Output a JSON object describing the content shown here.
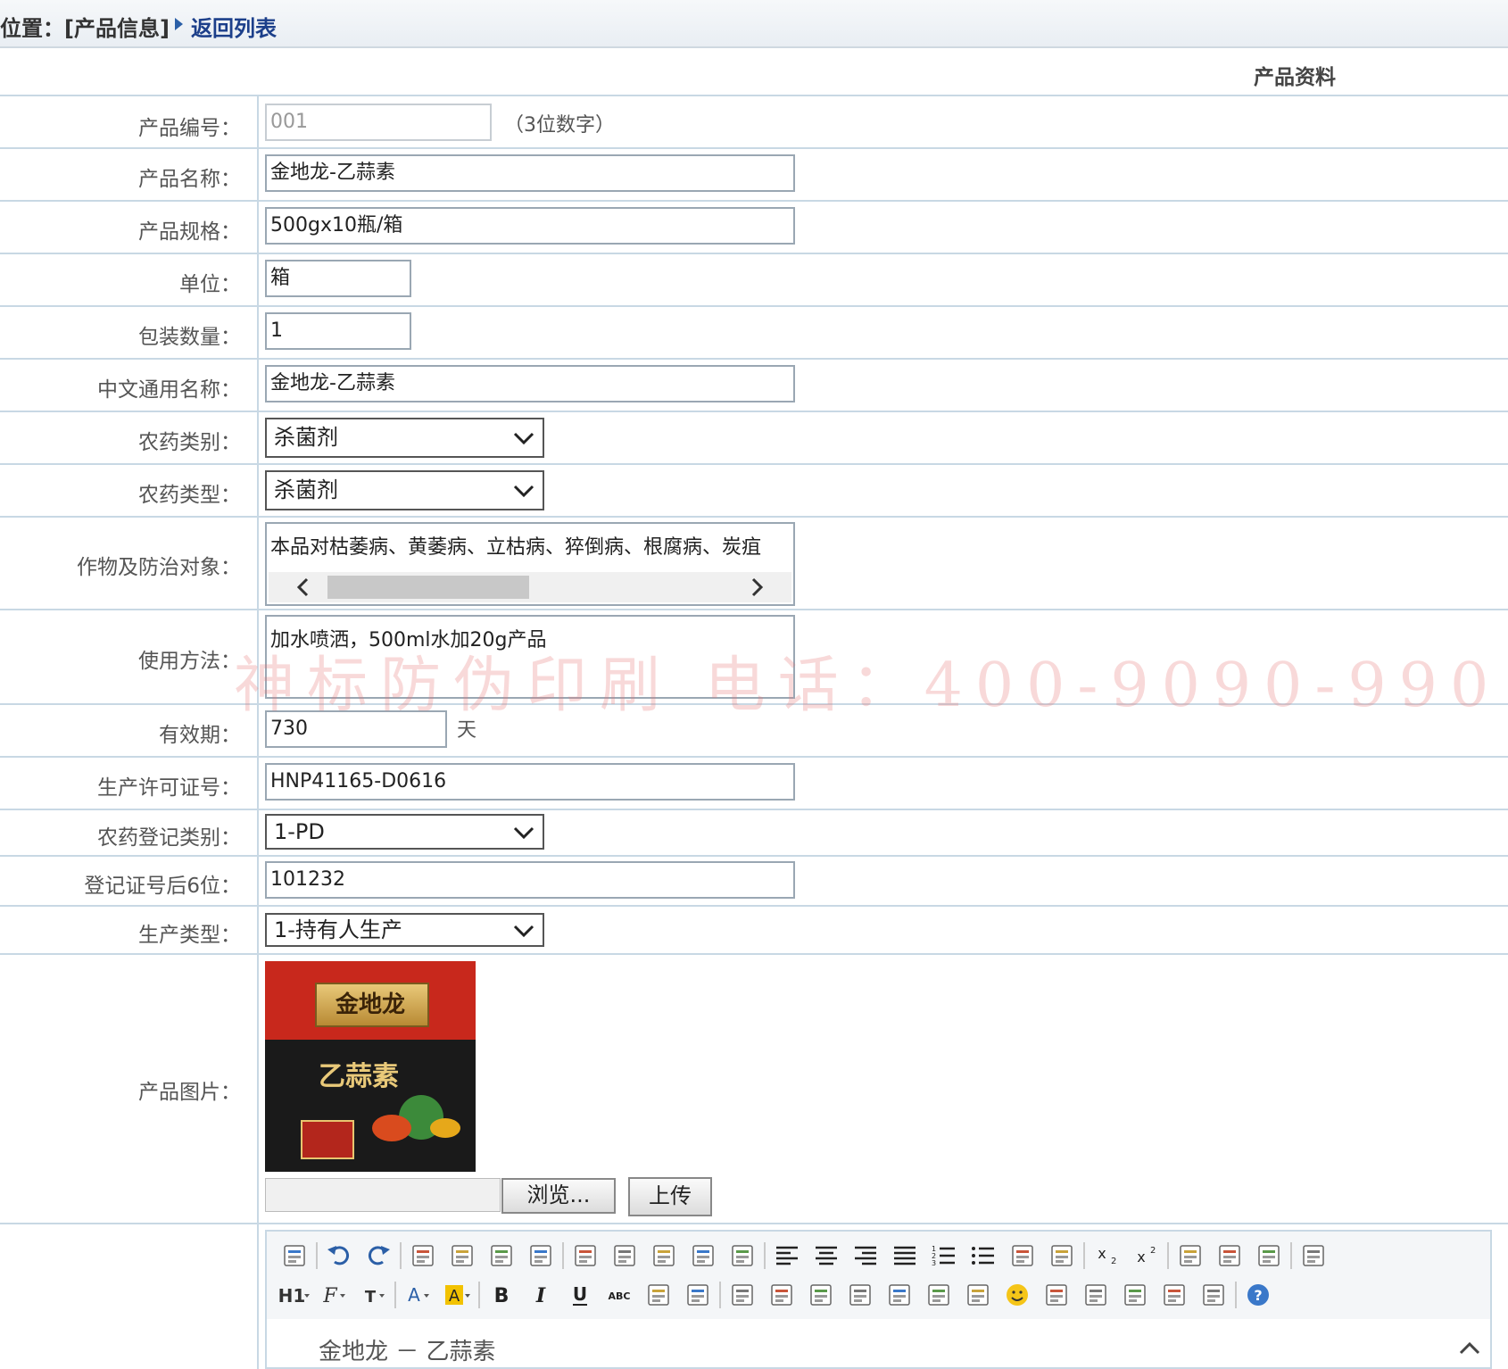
{
  "breadcrumb": {
    "prefix": "位置：[产品信息]",
    "back_link": "返回列表"
  },
  "section_title": "产品资料",
  "fields": {
    "code": {
      "label": "产品编号：",
      "value": "001",
      "hint": "（3位数字）"
    },
    "name": {
      "label": "产品名称：",
      "value": "金地龙-乙蒜素"
    },
    "spec": {
      "label": "产品规格：",
      "value": "500gx10瓶/箱"
    },
    "unit": {
      "label": "单位：",
      "value": "箱"
    },
    "pack_qty": {
      "label": "包装数量：",
      "value": "1"
    },
    "common_name": {
      "label": "中文通用名称：",
      "value": "金地龙-乙蒜素"
    },
    "pesticide_category": {
      "label": "农药类别：",
      "value": "杀菌剂"
    },
    "pesticide_type": {
      "label": "农药类型：",
      "value": "杀菌剂"
    },
    "crop_target": {
      "label": "作物及防治对象：",
      "value": "本品对枯萎病、黄萎病、立枯病、猝倒病、根腐病、炭疽"
    },
    "usage": {
      "label": "使用方法：",
      "value": "加水喷洒，500ml水加20g产品"
    },
    "shelf_life": {
      "label": "有效期：",
      "value": "730",
      "unit": "天"
    },
    "license_no": {
      "label": "生产许可证号：",
      "value": "HNP41165-D0616"
    },
    "reg_category": {
      "label": "农药登记类别：",
      "value": "1-PD"
    },
    "reg_last6": {
      "label": "登记证号后6位：",
      "value": "101232"
    },
    "production_type": {
      "label": "生产类型：",
      "value": "1-持有人生产"
    },
    "product_image": {
      "label": "产品图片：",
      "brand_text": "金地龙",
      "product_text": "乙蒜素",
      "browse_label": "浏览...",
      "upload_label": "上传"
    }
  },
  "watermark": "神标防伪印刷  电话：400-9090-990",
  "editor": {
    "content": "金地龙 － 乙蒜素",
    "toolbar_row1": [
      "source-icon",
      "undo-icon",
      "redo-icon",
      "preview-icon",
      "print-icon",
      "template-icon",
      "code-icon",
      "cut-icon",
      "copy-icon",
      "paste-icon",
      "paste-text-icon",
      "paste-word-icon",
      "align-left-icon",
      "align-center-icon",
      "align-right-icon",
      "justify-icon",
      "ordered-list-icon",
      "unordered-list-icon",
      "indent-icon",
      "outdent-icon",
      "subscript-icon",
      "superscript-icon",
      "clear-format-icon",
      "select-all-icon",
      "select-icon",
      "fullscreen-icon"
    ],
    "toolbar_row2": [
      "heading-icon",
      "font-family-icon",
      "font-size-icon",
      "font-color-icon",
      "highlight-icon",
      "bold-icon",
      "italic-icon",
      "underline-icon",
      "strikethrough-icon",
      "hr-icon",
      "eraser-icon",
      "image-insert-icon",
      "multi-image-icon",
      "flash-icon",
      "media-icon",
      "attachment-icon",
      "table-icon",
      "insert-row-icon",
      "emoticon-icon",
      "picture-icon",
      "page-break-icon",
      "anchor-icon",
      "link-icon",
      "unlink-icon",
      "help-icon"
    ]
  },
  "colors": {
    "border": "#c8d8e4",
    "link": "#1c3f8a",
    "accent": "#2b5fa7"
  }
}
